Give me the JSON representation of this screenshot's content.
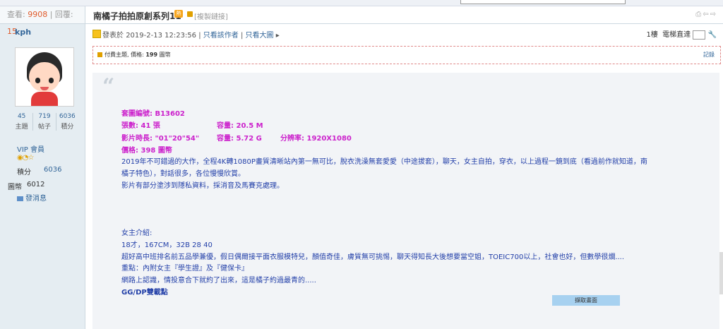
{
  "sidebar": {
    "views_label": "查看:",
    "views": "9908",
    "replies_label": "回覆:",
    "replies": "15",
    "author": "kph",
    "counts": [
      {
        "value": "45",
        "label": "主題"
      },
      {
        "value": "719",
        "label": "帖子"
      },
      {
        "value": "6036",
        "label": "積分"
      }
    ],
    "vip": "VIP 會員",
    "stars": "◉◔☆",
    "credit_label": "積分",
    "credit_value": "6036",
    "coins_label": "圖幣",
    "coins_value": "6012",
    "message": "發消息"
  },
  "thread": {
    "title": "南橘子拍拍原創系列11",
    "hot": "熱",
    "copy_link": "[複製鏈接]",
    "post_prefix": "發表於",
    "post_time": "2019-2-13 12:23:56",
    "only_author": "只看該作者",
    "only_big": "只看大圖",
    "floor": "1樓",
    "elevator": "電梯直達"
  },
  "paybox": {
    "text_prefix": "付費主題, 價格:",
    "price": "199",
    "unit": "圖幣",
    "record": "記錄"
  },
  "content": {
    "line1": "套圖編號:  B13602",
    "line2a": "張數:  41 張",
    "line2b": "容量:  20.5 M",
    "line3a": "影片時長:  \"01\"20\"54\"",
    "line3b": "容量:  5.72 G",
    "line3c": "分辨率:  1920X1080",
    "line4": "價格:  398 圖幣",
    "desc1": "2019年不可錯過的大作，全程4K轉1080P畫質清晰站內第一無可比，脫衣洗澡無套愛愛（中途拔套），聊天，女主自拍，穿衣，以上過程一鏡到底（看過前作就知道，南",
    "desc2": "橘子特色），對話很多，各位慢慢欣賞。",
    "desc3": "影片有部分塗涉到隱私資料，採消音及馬賽克處理。",
    "intro": "女主介紹:",
    "stats": "18才，167CM，32B 28 40",
    "desc4": "超好高中班排名前五品學兼優，假日偶爾接平面衣服模特兒，顏值奇佳，膚質無可挑惕，聊天得知長大後想要當空姐，TOEIC700以上，社會也好，但數學很爛....",
    "focus": "重點：內附女主『學生證』及『健保卡』",
    "net": "網路上認識，情投意合下就約了出來，這是橘子約過最青的.....",
    "gg": "GG/DP雙載點",
    "button": "擷取畫面"
  }
}
